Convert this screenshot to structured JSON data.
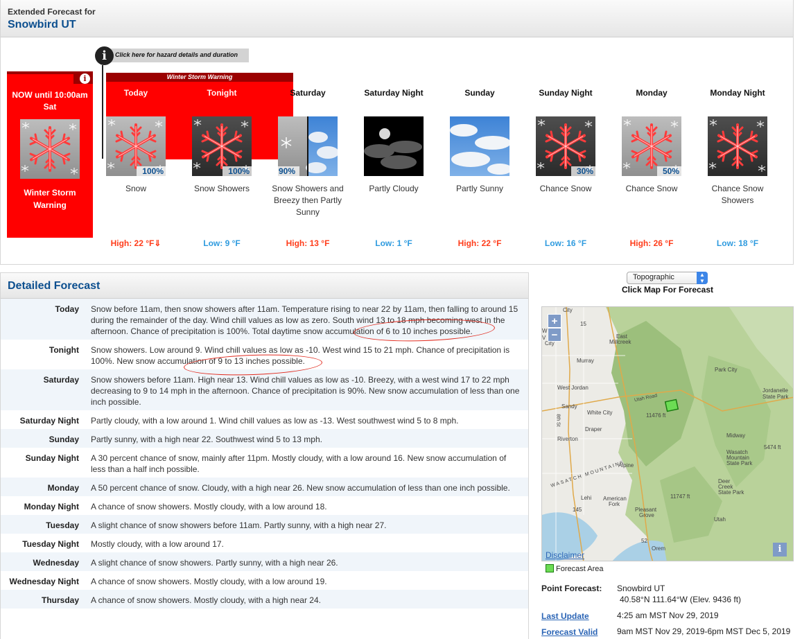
{
  "header": {
    "pretitle": "Extended Forecast for",
    "location": "Snowbird UT"
  },
  "hazard_link_text": "Click here for hazard details and duration",
  "hazard": {
    "when": "NOW until 10:00am Sat",
    "name": "Winter Storm Warning"
  },
  "warning_banner": "Winter Storm Warning",
  "periods": [
    {
      "name": "Today",
      "short": "Snow",
      "pop": "100%",
      "temp": "High: 22 °F⇓"
    },
    {
      "name": "Tonight",
      "short": "Snow Showers",
      "pop": "100%",
      "temp": "Low: 9 °F"
    },
    {
      "name": "Saturday",
      "short": "Snow Showers and Breezy then Partly Sunny",
      "pop": "90%",
      "temp": "High: 13 °F"
    },
    {
      "name": "Saturday Night",
      "short": "Partly Cloudy",
      "pop": "",
      "temp": "Low: 1 °F"
    },
    {
      "name": "Sunday",
      "short": "Partly Sunny",
      "pop": "",
      "temp": "High: 22 °F"
    },
    {
      "name": "Sunday Night",
      "short": "Chance Snow",
      "pop": "30%",
      "temp": "Low: 16 °F"
    },
    {
      "name": "Monday",
      "short": "Chance Snow",
      "pop": "50%",
      "temp": "High: 26 °F"
    },
    {
      "name": "Monday Night",
      "short": "Chance Snow Showers",
      "pop": "",
      "temp": "Low: 18 °F"
    }
  ],
  "detailed": {
    "title": "Detailed Forecast",
    "rows": [
      {
        "name": "Today",
        "text": "Snow before 11am, then snow showers after 11am. Temperature rising to near 22 by 11am, then falling to around 15 during the remainder of the day. Wind chill values as low as zero. South wind 13 to 18 mph becoming west in the afternoon. Chance of precipitation is 100%. Total daytime snow accumulation of 6 to 10 inches possible."
      },
      {
        "name": "Tonight",
        "text": "Snow showers. Low around 9. Wind chill values as low as -10. West wind 15 to 21 mph. Chance of precipitation is 100%. New snow accumulation of 9 to 13 inches possible."
      },
      {
        "name": "Saturday",
        "text": "Snow showers before 11am. High near 13. Wind chill values as low as -10. Breezy, with a west wind 17 to 22 mph decreasing to 9 to 14 mph in the afternoon. Chance of precipitation is 90%. New snow accumulation of less than one inch possible."
      },
      {
        "name": "Saturday Night",
        "text": "Partly cloudy, with a low around 1. Wind chill values as low as -13. West southwest wind 5 to 8 mph."
      },
      {
        "name": "Sunday",
        "text": "Partly sunny, with a high near 22. Southwest wind 5 to 13 mph."
      },
      {
        "name": "Sunday Night",
        "text": "A 30 percent chance of snow, mainly after 11pm. Mostly cloudy, with a low around 16. New snow accumulation of less than a half inch possible."
      },
      {
        "name": "Monday",
        "text": "A 50 percent chance of snow. Cloudy, with a high near 26. New snow accumulation of less than one inch possible."
      },
      {
        "name": "Monday Night",
        "text": "A chance of snow showers. Mostly cloudy, with a low around 18."
      },
      {
        "name": "Tuesday",
        "text": "A slight chance of snow showers before 11am. Partly sunny, with a high near 27."
      },
      {
        "name": "Tuesday Night",
        "text": "Mostly cloudy, with a low around 17."
      },
      {
        "name": "Wednesday",
        "text": "A slight chance of snow showers. Partly sunny, with a high near 26."
      },
      {
        "name": "Wednesday Night",
        "text": "A chance of snow showers. Mostly cloudy, with a low around 19."
      },
      {
        "name": "Thursday",
        "text": "A chance of snow showers. Mostly cloudy, with a high near 24."
      }
    ]
  },
  "map": {
    "layer": "Topographic",
    "caption": "Click Map For Forecast",
    "disclaimer": "Disclaimer",
    "legend": "Forecast Area",
    "labels": {
      "city": "City",
      "w": "W",
      "v": "V",
      "city2": "City",
      "east": "East",
      "millcreek": "Millcreek",
      "murray": "Murray",
      "park_city": "Park City",
      "west_jordan": "West Jordan",
      "sandy": "Sandy",
      "white_city": "White City",
      "jordanelle": "Jordanelle",
      "state_park": "State Park",
      "elev1": "11476 ft",
      "draper": "Draper",
      "riverton": "Riverton",
      "midway": "Midway",
      "wasatch": "Wasatch",
      "mountain": "Mountain",
      "state_park2": "State Park",
      "elev2": "5474 ft",
      "alpine": "Alpine",
      "deer": "Deer",
      "creek": "Creek",
      "state_park3": "State Park",
      "lehi": "Lehi",
      "american": "American",
      "fork": "Fork",
      "elev3": "11747 ft",
      "pleasant": "Pleasant",
      "grove": "Grove",
      "utah": "Utah",
      "orem": "Orem",
      "road1": "15",
      "road2": "145",
      "road3": "52",
      "range": "WASATCH MOUNTAINS",
      "street1": "8th St",
      "street2": "Utah Road"
    }
  },
  "point_info": {
    "point_label": "Point Forecast:",
    "point_name": "Snowbird UT",
    "coords": "40.58°N 111.64°W (Elev. 9436 ft)",
    "update_label": "Last Update",
    "update_value": "4:25 am MST Nov 29, 2019",
    "valid_label": "Forecast Valid",
    "valid_value": "9am MST Nov 29, 2019-6pm MST Dec 5, 2019"
  },
  "colors": {
    "hazard_red": "#ff0000",
    "hazard_dark": "#9b0000",
    "title_blue": "#0c4f8f",
    "high_temp": "#ff3c1a",
    "low_temp": "#2f9bdf"
  }
}
